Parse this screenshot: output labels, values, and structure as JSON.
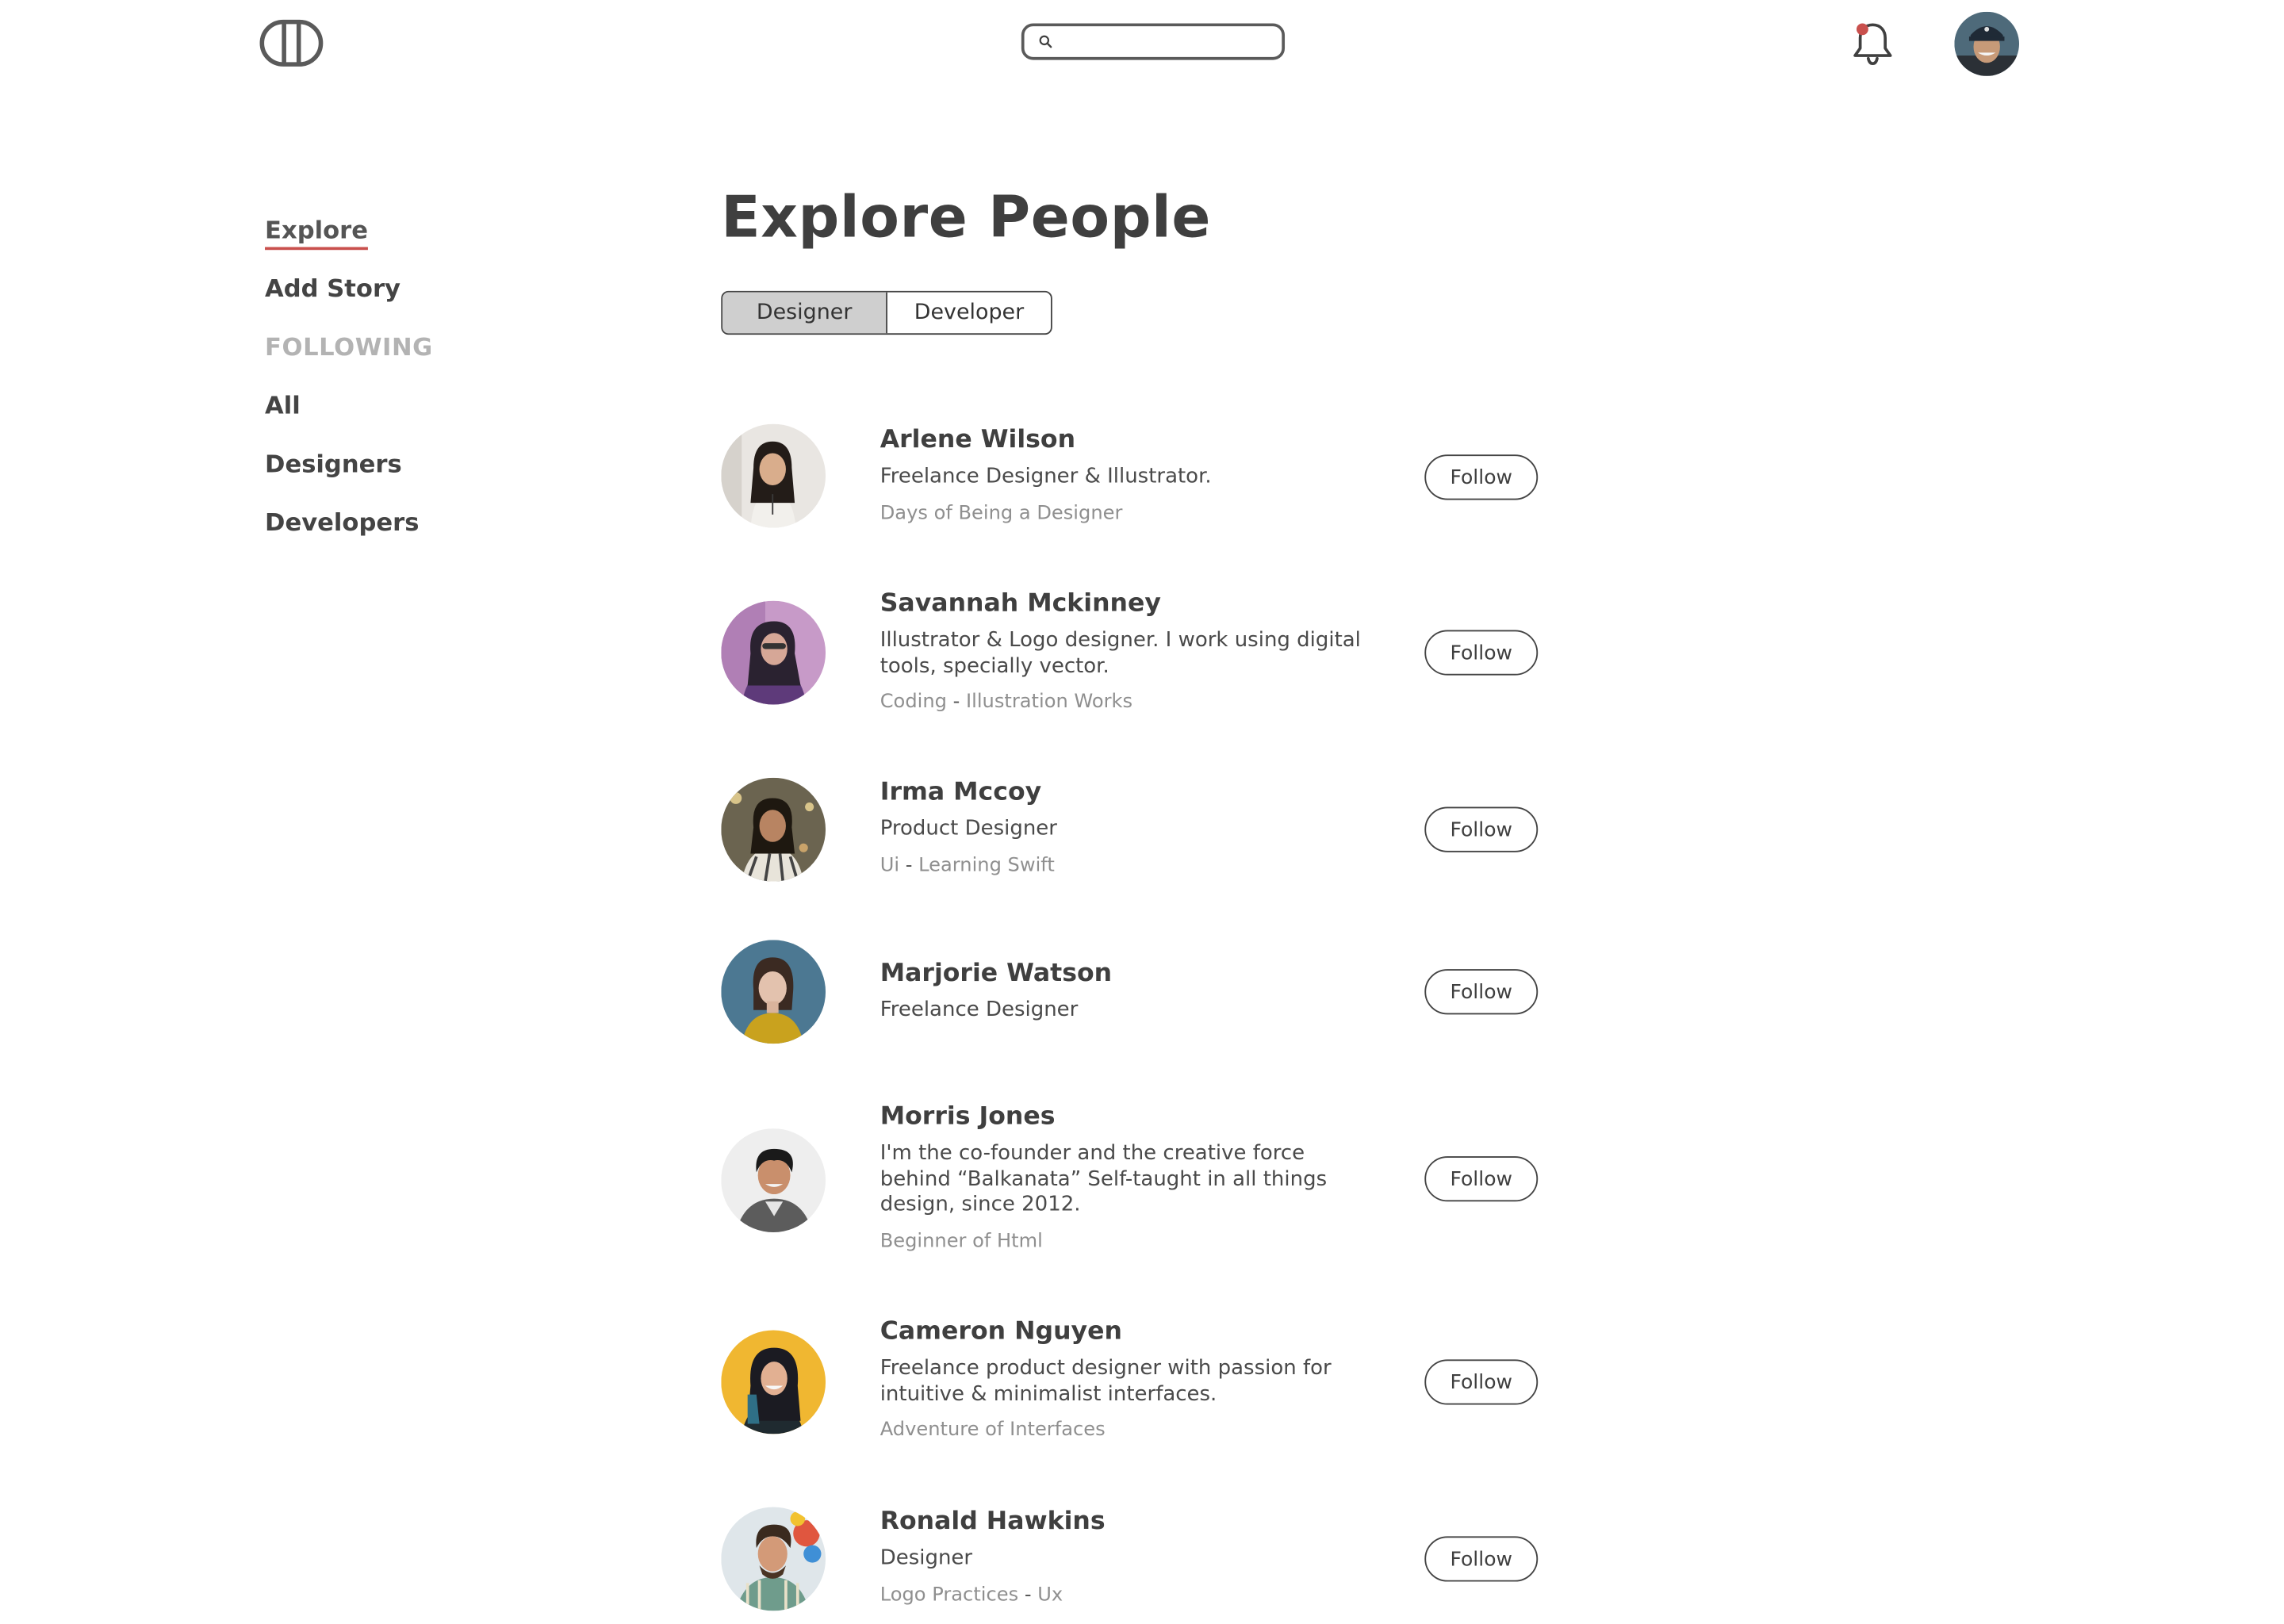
{
  "header": {
    "search_placeholder": "",
    "notification_dot_color": "#c9504d"
  },
  "sidebar": {
    "items": [
      {
        "label": "Explore",
        "active": true
      },
      {
        "label": "Add Story",
        "active": false
      }
    ],
    "heading": "FOLLOWING",
    "following": [
      {
        "label": "All"
      },
      {
        "label": "Designers"
      },
      {
        "label": "Developers"
      }
    ]
  },
  "main": {
    "title": "Explore People",
    "tabs": [
      {
        "label": "Designer",
        "selected": true
      },
      {
        "label": "Developer",
        "selected": false
      }
    ],
    "follow_label": "Follow",
    "people": [
      {
        "name": "Arlene Wilson",
        "bio": "Freelance Designer & Illustrator.",
        "tags": [
          "Days of Being a Designer"
        ],
        "avatar_bg": "#e9e6e2"
      },
      {
        "name": "Savannah Mckinney",
        "bio": "Illustrator & Logo designer. I work using digital tools, specially vector.",
        "tags": [
          "Coding",
          "Illustration Works"
        ],
        "avatar_bg": "#c79ac8"
      },
      {
        "name": "Irma Mccoy",
        "bio": "Product Designer",
        "tags": [
          "Ui",
          "Learning Swift"
        ],
        "avatar_bg": "#6b6450"
      },
      {
        "name": "Marjorie Watson",
        "bio": "Freelance Designer",
        "tags": [],
        "avatar_bg": "#4c7892"
      },
      {
        "name": "Morris Jones",
        "bio": "I'm the co-founder and the creative force behind “Balkanata” Self-taught in all things design, since 2012.",
        "tags": [
          "Beginner of Html"
        ],
        "avatar_bg": "#eeeeee"
      },
      {
        "name": "Cameron Nguyen",
        "bio": "Freelance product designer with passion for intuitive & minimalist interfaces.",
        "tags": [
          "Adventure of Interfaces"
        ],
        "avatar_bg": "#f0b731"
      },
      {
        "name": "Ronald Hawkins",
        "bio": "Designer",
        "tags": [
          "Logo Practices",
          "Ux"
        ],
        "avatar_bg": "#dfe6ea"
      }
    ]
  }
}
